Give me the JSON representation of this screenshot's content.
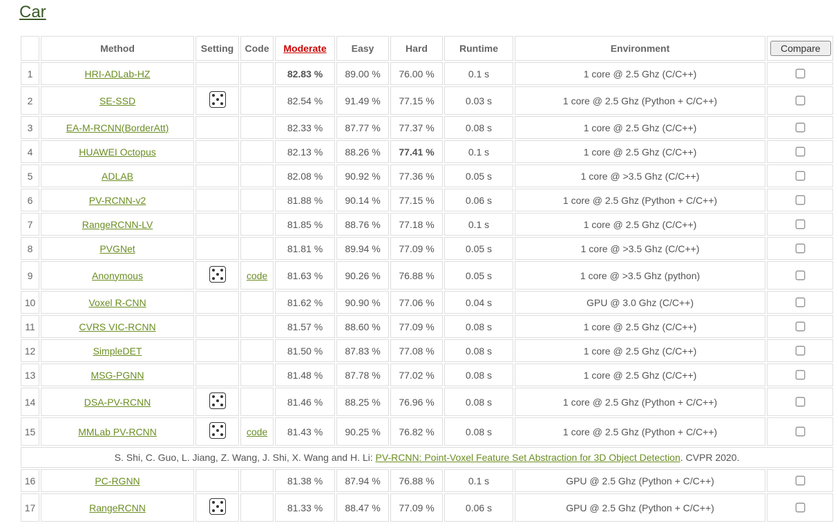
{
  "section_title": "Car",
  "columns": {
    "method": "Method",
    "setting": "Setting",
    "code": "Code",
    "moderate": "Moderate",
    "easy": "Easy",
    "hard": "Hard",
    "runtime": "Runtime",
    "environment": "Environment",
    "compare": "Compare"
  },
  "code_label": "code",
  "citation_15": {
    "authors": "S. Shi, C. Guo, L. Jiang, Z. Wang, J. Shi, X. Wang and H. Li: ",
    "title": "PV-RCNN: Point-Voxel Feature Set Abstraction for 3D Object Detection",
    "venue": ". CVPR 2020."
  },
  "chart_data": {
    "type": "table",
    "columns": [
      "rank",
      "method",
      "setting_dice",
      "has_code",
      "moderate",
      "easy",
      "hard",
      "hard_bold",
      "runtime",
      "environment"
    ],
    "rows": [
      {
        "rank": 1,
        "method": "HRI-ADLab-HZ",
        "setting_dice": false,
        "has_code": false,
        "moderate": "82.83 %",
        "easy": "89.00 %",
        "hard": "76.00 %",
        "hard_bold": false,
        "runtime": "0.1 s",
        "environment": "1 core @ 2.5 Ghz (C/C++)"
      },
      {
        "rank": 2,
        "method": "SE-SSD",
        "setting_dice": true,
        "has_code": false,
        "moderate": "82.54 %",
        "easy": "91.49 %",
        "hard": "77.15 %",
        "hard_bold": false,
        "runtime": "0.03 s",
        "environment": "1 core @ 2.5 Ghz (Python + C/C++)"
      },
      {
        "rank": 3,
        "method": "EA-M-RCNN(BorderAtt)",
        "setting_dice": false,
        "has_code": false,
        "moderate": "82.33 %",
        "easy": "87.77 %",
        "hard": "77.37 %",
        "hard_bold": false,
        "runtime": "0.08 s",
        "environment": "1 core @ 2.5 Ghz (C/C++)"
      },
      {
        "rank": 4,
        "method": "HUAWEI Octopus",
        "setting_dice": false,
        "has_code": false,
        "moderate": "82.13 %",
        "easy": "88.26 %",
        "hard": "77.41 %",
        "hard_bold": true,
        "runtime": "0.1 s",
        "environment": "1 core @ 2.5 Ghz (C/C++)"
      },
      {
        "rank": 5,
        "method": "ADLAB",
        "setting_dice": false,
        "has_code": false,
        "moderate": "82.08 %",
        "easy": "90.92 %",
        "hard": "77.36 %",
        "hard_bold": false,
        "runtime": "0.05 s",
        "environment": "1 core @ >3.5 Ghz (C/C++)"
      },
      {
        "rank": 6,
        "method": "PV-RCNN-v2",
        "setting_dice": false,
        "has_code": false,
        "moderate": "81.88 %",
        "easy": "90.14 %",
        "hard": "77.15 %",
        "hard_bold": false,
        "runtime": "0.06 s",
        "environment": "1 core @ 2.5 Ghz (Python + C/C++)"
      },
      {
        "rank": 7,
        "method": "RangeRCNN-LV",
        "setting_dice": false,
        "has_code": false,
        "moderate": "81.85 %",
        "easy": "88.76 %",
        "hard": "77.18 %",
        "hard_bold": false,
        "runtime": "0.1 s",
        "environment": "1 core @ 2.5 Ghz (C/C++)"
      },
      {
        "rank": 8,
        "method": "PVGNet",
        "setting_dice": false,
        "has_code": false,
        "moderate": "81.81 %",
        "easy": "89.94 %",
        "hard": "77.09 %",
        "hard_bold": false,
        "runtime": "0.05 s",
        "environment": "1 core @ >3.5 Ghz (C/C++)"
      },
      {
        "rank": 9,
        "method": "Anonymous",
        "setting_dice": true,
        "has_code": true,
        "moderate": "81.63 %",
        "easy": "90.26 %",
        "hard": "76.88 %",
        "hard_bold": false,
        "runtime": "0.05 s",
        "environment": "1 core @ >3.5 Ghz (python)"
      },
      {
        "rank": 10,
        "method": "Voxel R-CNN",
        "setting_dice": false,
        "has_code": false,
        "moderate": "81.62 %",
        "easy": "90.90 %",
        "hard": "77.06 %",
        "hard_bold": false,
        "runtime": "0.04 s",
        "environment": "GPU @ 3.0 Ghz (C/C++)"
      },
      {
        "rank": 11,
        "method": "CVRS VIC-RCNN",
        "setting_dice": false,
        "has_code": false,
        "moderate": "81.57 %",
        "easy": "88.60 %",
        "hard": "77.09 %",
        "hard_bold": false,
        "runtime": "0.08 s",
        "environment": "1 core @ 2.5 Ghz (C/C++)"
      },
      {
        "rank": 12,
        "method": "SimpleDET",
        "setting_dice": false,
        "has_code": false,
        "moderate": "81.50 %",
        "easy": "87.83 %",
        "hard": "77.08 %",
        "hard_bold": false,
        "runtime": "0.08 s",
        "environment": "1 core @ 2.5 Ghz (C/C++)"
      },
      {
        "rank": 13,
        "method": "MSG-PGNN",
        "setting_dice": false,
        "has_code": false,
        "moderate": "81.48 %",
        "easy": "87.78 %",
        "hard": "77.02 %",
        "hard_bold": false,
        "runtime": "0.08 s",
        "environment": "1 core @ 2.5 Ghz (C/C++)"
      },
      {
        "rank": 14,
        "method": "DSA-PV-RCNN",
        "setting_dice": true,
        "has_code": false,
        "moderate": "81.46 %",
        "easy": "88.25 %",
        "hard": "76.96 %",
        "hard_bold": false,
        "runtime": "0.08 s",
        "environment": "1 core @ 2.5 Ghz (Python + C/C++)"
      },
      {
        "rank": 15,
        "method": "MMLab PV-RCNN",
        "setting_dice": true,
        "has_code": true,
        "moderate": "81.43 %",
        "easy": "90.25 %",
        "hard": "76.82 %",
        "hard_bold": false,
        "runtime": "0.08 s",
        "environment": "1 core @ 2.5 Ghz (Python + C/C++)"
      },
      {
        "rank": 16,
        "method": "PC-RGNN",
        "setting_dice": false,
        "has_code": false,
        "moderate": "81.38 %",
        "easy": "87.94 %",
        "hard": "76.88 %",
        "hard_bold": false,
        "runtime": "0.1 s",
        "environment": "GPU @ 2.5 Ghz (Python + C/C++)"
      },
      {
        "rank": 17,
        "method": "RangeRCNN",
        "setting_dice": true,
        "has_code": false,
        "moderate": "81.33 %",
        "easy": "88.47 %",
        "hard": "77.09 %",
        "hard_bold": false,
        "runtime": "0.06 s",
        "environment": "GPU @ 2.5 Ghz (Python + C/C++)"
      }
    ]
  }
}
